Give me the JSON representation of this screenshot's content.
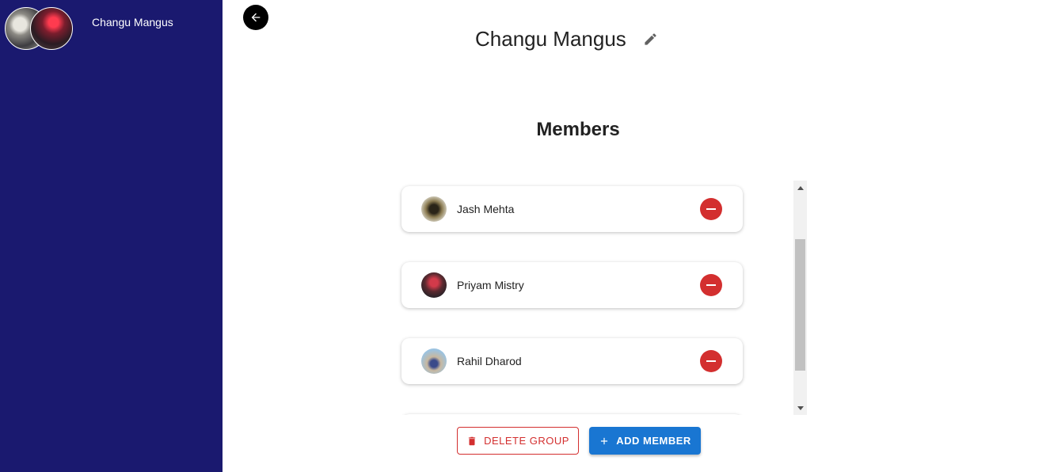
{
  "sidebar": {
    "group": {
      "name": "Changu Mangus"
    }
  },
  "header": {
    "title": "Changu Mangus"
  },
  "members": {
    "heading": "Members",
    "list": [
      {
        "name": "Jash Mehta"
      },
      {
        "name": "Priyam Mistry"
      },
      {
        "name": "Rahil Dharod"
      }
    ]
  },
  "actions": {
    "delete_label": "DELETE GROUP",
    "add_label": "ADD MEMBER"
  },
  "colors": {
    "sidebar_bg": "#1a196f",
    "danger": "#d32f2f",
    "primary": "#1976d2"
  },
  "icons": {
    "back": "arrow-left-icon",
    "edit": "pencil-icon",
    "remove": "minus-circle-icon",
    "delete": "trash-icon",
    "add": "plus-icon"
  }
}
